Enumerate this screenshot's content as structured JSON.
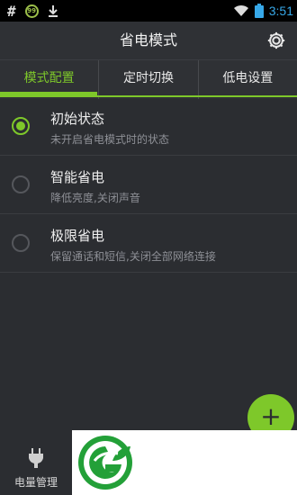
{
  "status_bar": {
    "left_glyph": "#",
    "circle_badge": "99",
    "time": "3:51",
    "icons": [
      "hash-icon",
      "badge-icon",
      "download-icon",
      "wifi-icon",
      "battery-icon"
    ]
  },
  "header": {
    "title": "省电模式",
    "settings_icon": "gear-icon"
  },
  "tabs": [
    {
      "label": "模式配置",
      "active": true
    },
    {
      "label": "定时切换",
      "active": false
    },
    {
      "label": "低电设置",
      "active": false
    }
  ],
  "modes": [
    {
      "title": "初始状态",
      "subtitle": "未开启省电模式时的状态",
      "selected": true
    },
    {
      "title": "智能省电",
      "subtitle": "降低亮度,关闭声音",
      "selected": false
    },
    {
      "title": "极限省电",
      "subtitle": "保留通话和短信,关闭全部网络连接",
      "selected": false
    }
  ],
  "fab": {
    "label": "+"
  },
  "bottom_nav": {
    "label": "电量管理",
    "icon": "plug-icon"
  },
  "colors": {
    "accent": "#7ec82a",
    "background": "#2b2d31",
    "time": "#37a8e8"
  }
}
